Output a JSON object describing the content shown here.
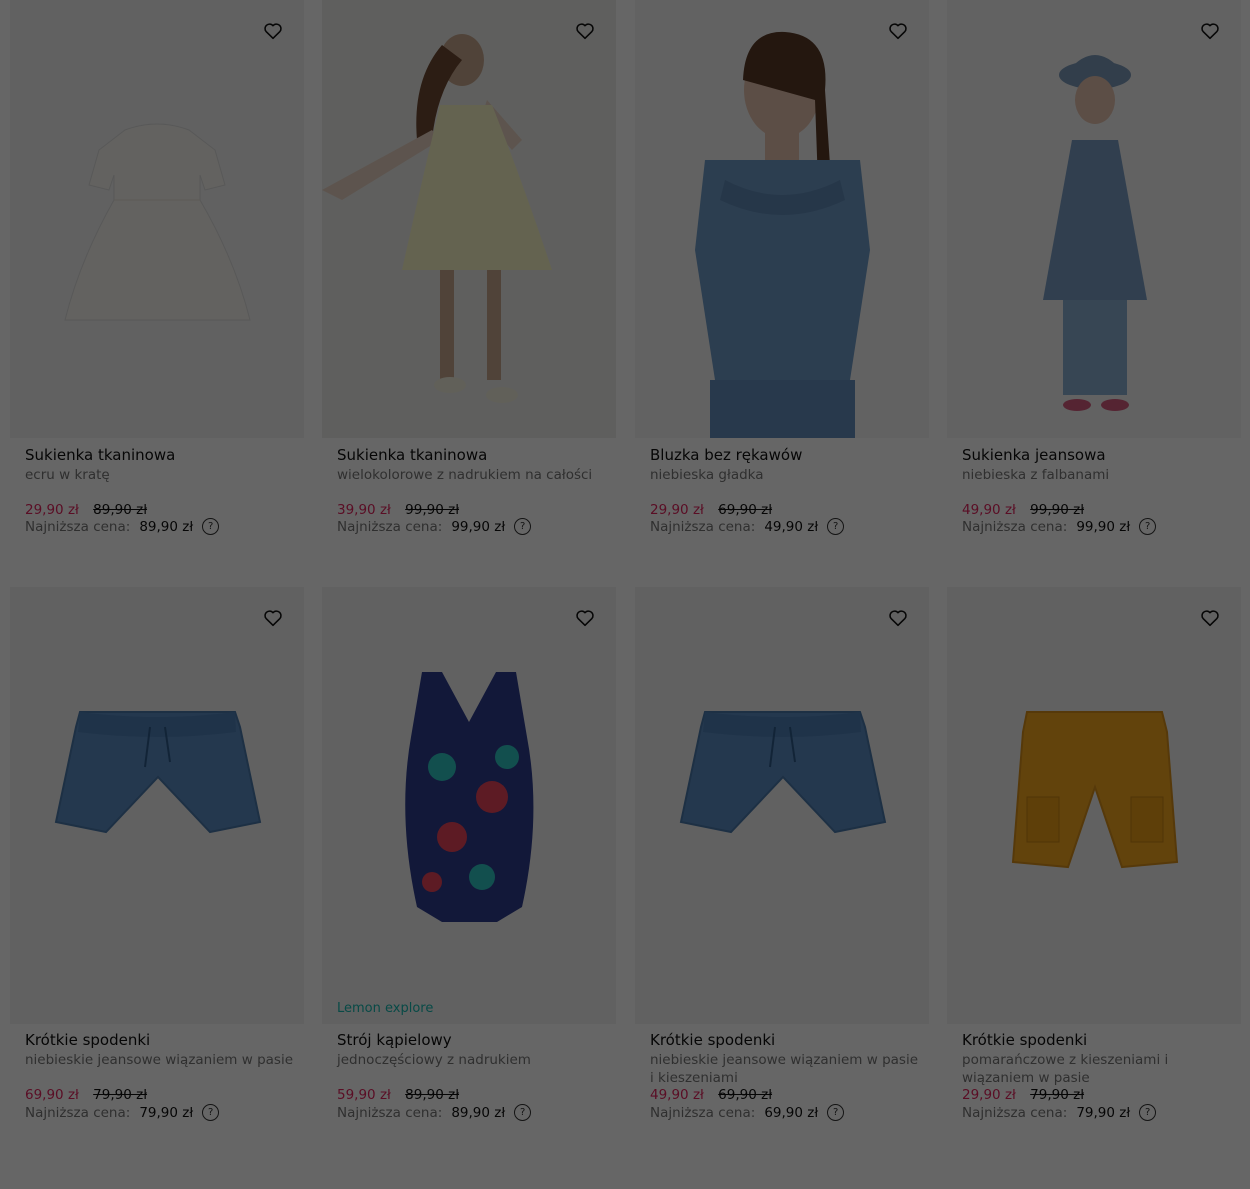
{
  "products": [
    {
      "name": "Sukienka tkaninowa",
      "desc": "ecru w kratę",
      "price": "29,90 zł",
      "old_price": "89,90 zł",
      "lowest_label": "Najniższa cena:",
      "lowest_value": "89,90 zł",
      "image": "white-dress",
      "brand": ""
    },
    {
      "name": "Sukienka tkaninowa",
      "desc": "wielokolorowe z nadrukiem na całości",
      "price": "39,90 zł",
      "old_price": "99,90 zł",
      "lowest_label": "Najniższa cena:",
      "lowest_value": "99,90 zł",
      "image": "girl-yellow-dress",
      "brand": ""
    },
    {
      "name": "Bluzka bez rękawów",
      "desc": "niebieska gładka",
      "price": "29,90 zł",
      "old_price": "69,90 zł",
      "lowest_label": "Najniższa cena:",
      "lowest_value": "49,90 zł",
      "image": "girl-denim-top",
      "brand": ""
    },
    {
      "name": "Sukienka jeansowa",
      "desc": "niebieska z falbanami",
      "price": "49,90 zł",
      "old_price": "99,90 zł",
      "lowest_label": "Najniższa cena:",
      "lowest_value": "99,90 zł",
      "image": "girl-denim-dress",
      "brand": ""
    },
    {
      "name": "Krótkie spodenki",
      "desc": "niebieskie jeansowe wiązaniem w pasie",
      "price": "69,90 zł",
      "old_price": "79,90 zł",
      "lowest_label": "Najniższa cena:",
      "lowest_value": "79,90 zł",
      "image": "denim-shorts",
      "brand": ""
    },
    {
      "name": "Strój kąpielowy",
      "desc": "jednoczęściowy z nadrukiem",
      "price": "59,90 zł",
      "old_price": "89,90 zł",
      "lowest_label": "Najniższa cena:",
      "lowest_value": "89,90 zł",
      "image": "swimsuit",
      "brand": "Lemon explore"
    },
    {
      "name": "Krótkie spodenki",
      "desc": "niebieskie jeansowe wiązaniem w pasie i kieszeniami",
      "price": "49,90 zł",
      "old_price": "69,90 zł",
      "lowest_label": "Najniższa cena:",
      "lowest_value": "69,90 zł",
      "image": "denim-shorts",
      "brand": ""
    },
    {
      "name": "Krótkie spodenki",
      "desc": "pomarańczowe z kieszeniami i wiązaniem w pasie",
      "price": "29,90 zł",
      "old_price": "79,90 zł",
      "lowest_label": "Najniższa cena:",
      "lowest_value": "79,90 zł",
      "image": "orange-shorts",
      "brand": ""
    }
  ],
  "icons": {
    "favorite": "heart-outline-icon",
    "help": "question-circle-icon"
  },
  "colors": {
    "sale_price": "#e0245e",
    "brand_label": "#14b8b0",
    "overlay": "rgba(0,0,0,0.6)"
  }
}
